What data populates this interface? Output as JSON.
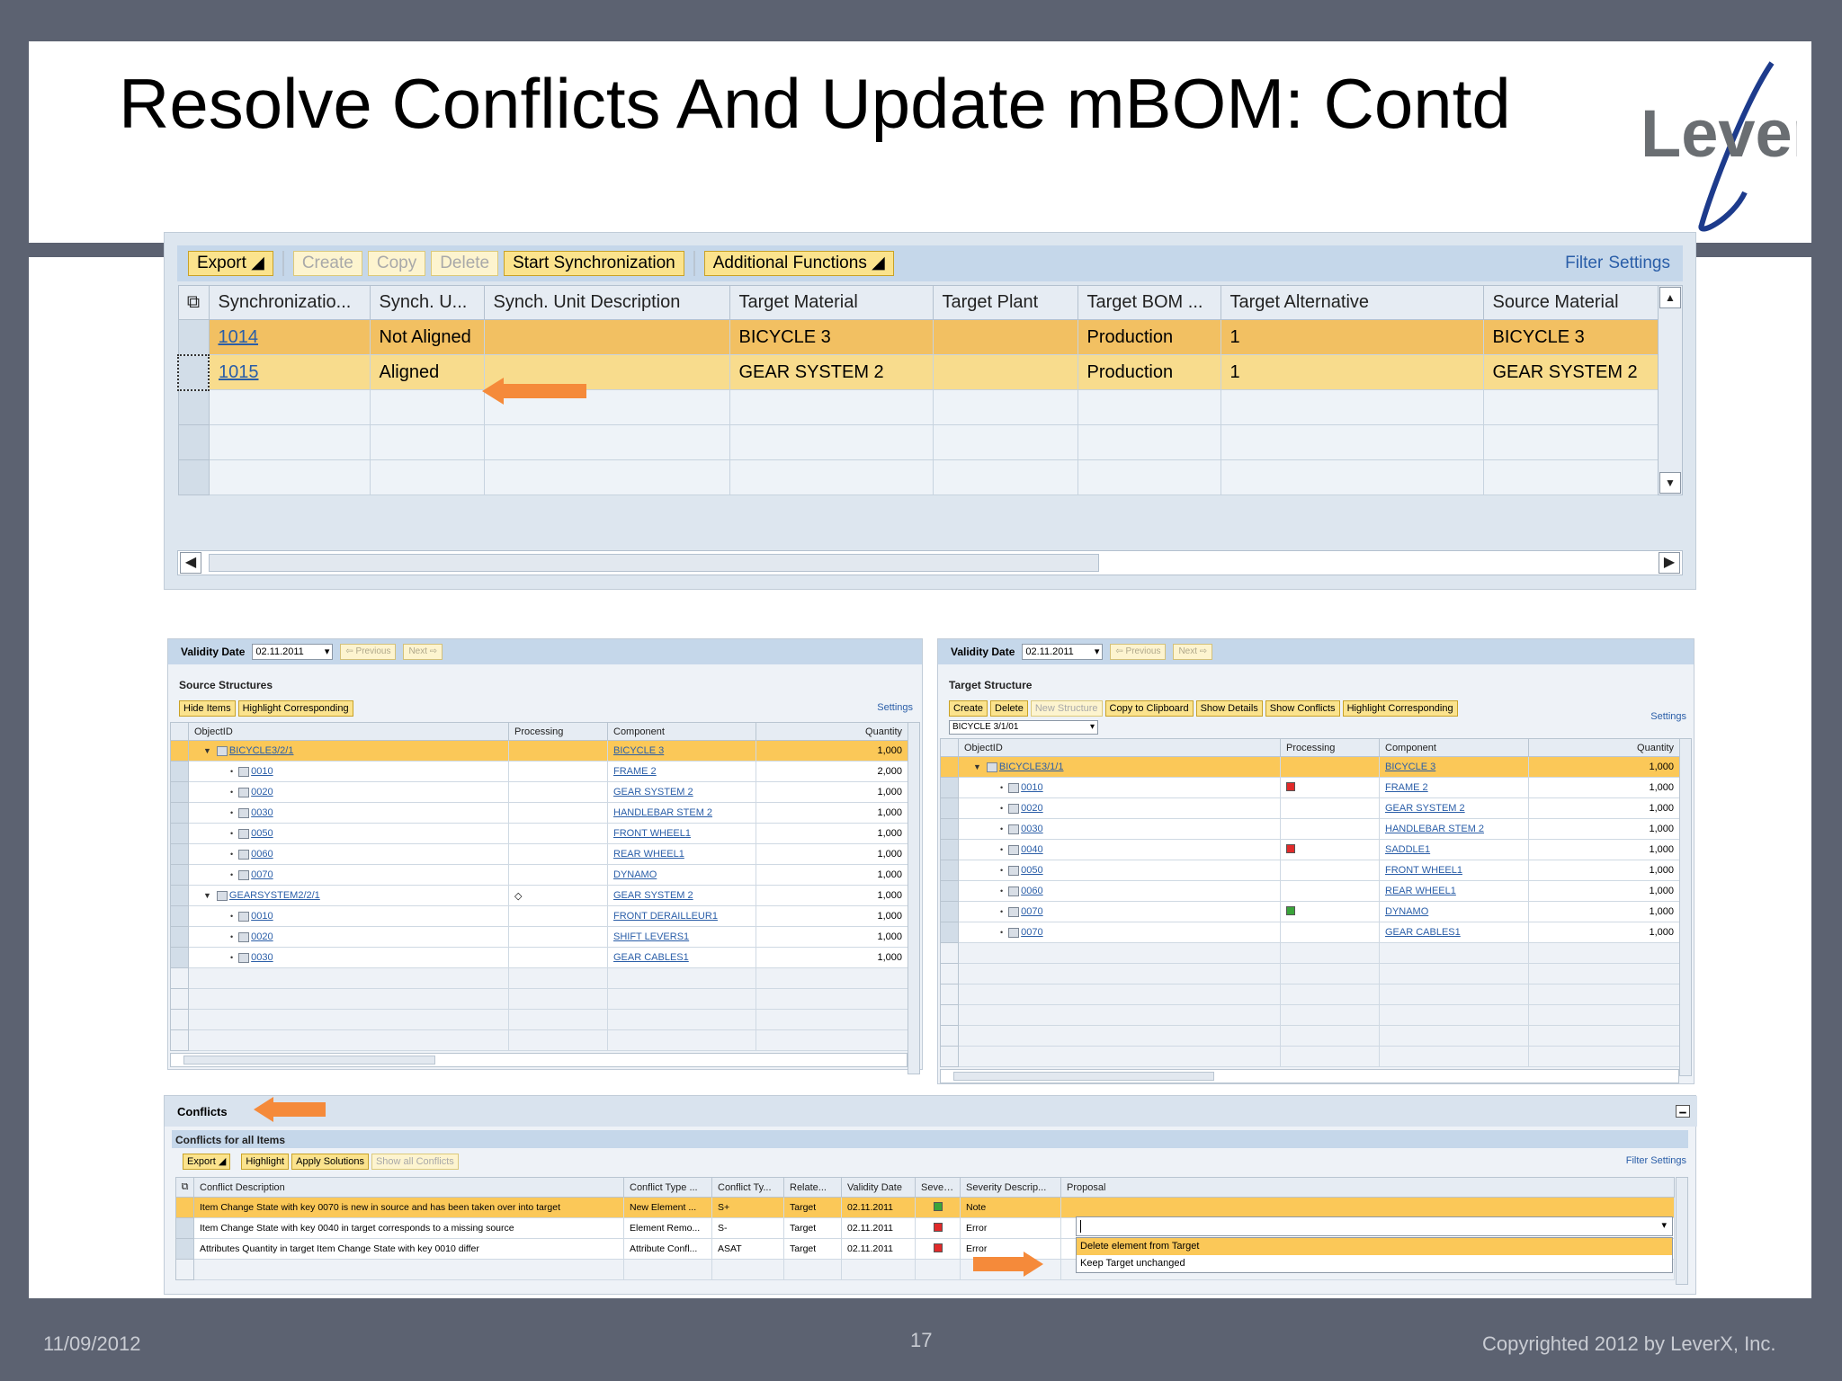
{
  "slide": {
    "title": "Resolve Conflicts And Update mBOM: Contd",
    "logo_text": "LeverX",
    "footer_date": "11/09/2012",
    "page_number": "17",
    "copyright": "Copyrighted 2012 by LeverX, Inc."
  },
  "colors": {
    "accent_orange": "#f58a3a",
    "sap_button": "#fbe38d",
    "selected_row": "#f2c062",
    "header_blue": "#c5d7ea"
  },
  "sync_panel": {
    "toolbar": {
      "export": "Export",
      "create": "Create",
      "copy": "Copy",
      "delete": "Delete",
      "start_sync": "Start Synchronization",
      "additional": "Additional Functions",
      "filter": "Filter",
      "settings": "Settings"
    },
    "columns": [
      "Synchronizatio...",
      "Synch. U...",
      "Synch. Unit Description",
      "Target Material",
      "Target Plant",
      "Target BOM ...",
      "Target Alternative",
      "Source Material"
    ],
    "rows": [
      {
        "id": "1014",
        "status": "Not Aligned",
        "desc": "",
        "target_material": "BICYCLE 3",
        "plant": "",
        "bom": "Production",
        "alt": "1",
        "source": "BICYCLE 3"
      },
      {
        "id": "1015",
        "status": "Aligned",
        "desc": "",
        "target_material": "GEAR SYSTEM 2",
        "plant": "",
        "bom": "Production",
        "alt": "1",
        "source": "GEAR SYSTEM 2"
      }
    ]
  },
  "source_panel": {
    "validity_label": "Validity Date",
    "date": "02.11.2011",
    "previous": "Previous",
    "next": "Next",
    "section": "Source Structures",
    "hide_items": "Hide Items",
    "highlight": "Highlight Corresponding",
    "settings": "Settings",
    "columns": [
      "ObjectID",
      "Processing",
      "Component",
      "Quantity"
    ],
    "rows": [
      {
        "obj": "BICYCLE3/2/1",
        "comp": "BICYCLE 3",
        "qty": "1,000"
      },
      {
        "obj": "0010",
        "comp": "FRAME 2",
        "qty": "2,000"
      },
      {
        "obj": "0020",
        "comp": "GEAR SYSTEM 2",
        "qty": "1,000"
      },
      {
        "obj": "0030",
        "comp": "HANDLEBAR STEM 2",
        "qty": "1,000"
      },
      {
        "obj": "0050",
        "comp": "FRONT WHEEL1",
        "qty": "1,000"
      },
      {
        "obj": "0060",
        "comp": "REAR WHEEL1",
        "qty": "1,000"
      },
      {
        "obj": "0070",
        "comp": "DYNAMO",
        "qty": "1,000"
      },
      {
        "obj": "GEARSYSTEM2/2/1",
        "comp": "GEAR SYSTEM 2",
        "qty": "1,000"
      },
      {
        "obj": "0010",
        "comp": "FRONT DERAILLEUR1",
        "qty": "1,000"
      },
      {
        "obj": "0020",
        "comp": "SHIFT LEVERS1",
        "qty": "1,000"
      },
      {
        "obj": "0030",
        "comp": "GEAR CABLES1",
        "qty": "1,000"
      }
    ]
  },
  "target_panel": {
    "validity_label": "Validity Date",
    "date": "02.11.2011",
    "previous": "Previous",
    "next": "Next",
    "section": "Target Structure",
    "buttons": [
      "Create",
      "Delete",
      "New Structure",
      "Copy to Clipboard",
      "Show Details",
      "Show Conflicts",
      "Highlight Corresponding"
    ],
    "settings": "Settings",
    "selector": "BICYCLE 3/1/01",
    "columns": [
      "ObjectID",
      "Processing",
      "Component",
      "Quantity"
    ],
    "rows": [
      {
        "obj": "BICYCLE3/1/1",
        "comp": "BICYCLE 3",
        "qty": "1,000",
        "status": ""
      },
      {
        "obj": "0010",
        "comp": "FRAME 2",
        "qty": "1,000",
        "status": "red"
      },
      {
        "obj": "0020",
        "comp": "GEAR SYSTEM 2",
        "qty": "1,000",
        "status": ""
      },
      {
        "obj": "0030",
        "comp": "HANDLEBAR STEM 2",
        "qty": "1,000",
        "status": ""
      },
      {
        "obj": "0040",
        "comp": "SADDLE1",
        "qty": "1,000",
        "status": "red"
      },
      {
        "obj": "0050",
        "comp": "FRONT WHEEL1",
        "qty": "1,000",
        "status": ""
      },
      {
        "obj": "0060",
        "comp": "REAR WHEEL1",
        "qty": "1,000",
        "status": ""
      },
      {
        "obj": "0070",
        "comp": "DYNAMO",
        "qty": "1,000",
        "status": "green"
      },
      {
        "obj": "0070",
        "comp": "GEAR CABLES1",
        "qty": "1,000",
        "status": ""
      }
    ]
  },
  "conflicts_panel": {
    "header": "Conflicts",
    "section": "Conflicts for all Items",
    "export": "Export",
    "highlight": "Highlight",
    "apply": "Apply Solutions",
    "show_all": "Show all Conflicts",
    "filter": "Filter",
    "settings": "Settings",
    "columns": [
      "Conflict Description",
      "Conflict Type ...",
      "Conflict Ty...",
      "Relate...",
      "Validity Date",
      "Severity",
      "Severity Descrip...",
      "Proposal"
    ],
    "rows": [
      {
        "desc": "Item Change State with key 0070 is new in source and has been taken over into target",
        "type": "New Element ...",
        "ty": "S+",
        "rel": "Target",
        "date": "02.11.2011",
        "sev": "green",
        "sevdesc": "Note",
        "proposal": ""
      },
      {
        "desc": "Item Change State with key 0040 in target corresponds to a missing source",
        "type": "Element Remo...",
        "ty": "S-",
        "rel": "Target",
        "date": "02.11.2011",
        "sev": "red",
        "sevdesc": "Error",
        "proposal": ""
      },
      {
        "desc": "Attributes Quantity in target Item Change State with key 0010 differ",
        "type": "Attribute Confl...",
        "ty": "ASAT",
        "rel": "Target",
        "date": "02.11.2011",
        "sev": "red",
        "sevdesc": "Error",
        "proposal": ""
      }
    ],
    "dropdown_options": [
      "Delete element from Target",
      "Keep Target unchanged"
    ]
  }
}
